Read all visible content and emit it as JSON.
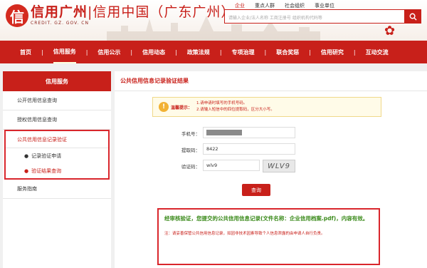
{
  "header": {
    "logo_mark": "信",
    "logo_main": "信用广州",
    "logo_main2": "信用中国（广东广州）",
    "logo_sub": "CREDIT. GZ. GOV. CN",
    "top_links": [
      "企业",
      "重点人群",
      "社会组织",
      "事业单位"
    ],
    "search_placeholder": "请输入企业/法人名称 工商注册号 组织机构代码等"
  },
  "nav": {
    "items": [
      "首页",
      "信用服务",
      "信用公示",
      "信用动态",
      "政策法规",
      "专项治理",
      "联合奖惩",
      "信用研究",
      "互动交流"
    ],
    "active_index": 1
  },
  "sidebar": {
    "title": "信用服务",
    "items": [
      "公开信用信息查询",
      "授权信用信息查询"
    ],
    "group_title": "公共信用信息记录验证",
    "sub_items": [
      "记录验证申请",
      "验证结果查询"
    ],
    "bottom_item": "服务指南"
  },
  "main": {
    "title": "公共信用信息记录验证结果",
    "notice_label": "温馨提示：",
    "notice_lines": [
      "1.请申请时填写的手机号码。",
      "2.请输入短信中的四位提取码，区分大小写。"
    ],
    "phone_label": "手机号：",
    "code_label": "提取码：",
    "code_value": "8422",
    "captcha_label": "验证码：",
    "captcha_value": "wlv9",
    "captcha_image_text": "WLV9",
    "query_button": "查询",
    "result_main": "经审核验证，您提交的公共信用信息记录(文件名称：企业信用档案.pdf)，内容有效。",
    "result_note": "注：请妥善保管公共信用信息记录，如因非技术因素导致个人信息泄露的由申请人自行负责。"
  },
  "colors": {
    "brand_red": "#c8201a",
    "success_green": "#3a8a1a"
  }
}
